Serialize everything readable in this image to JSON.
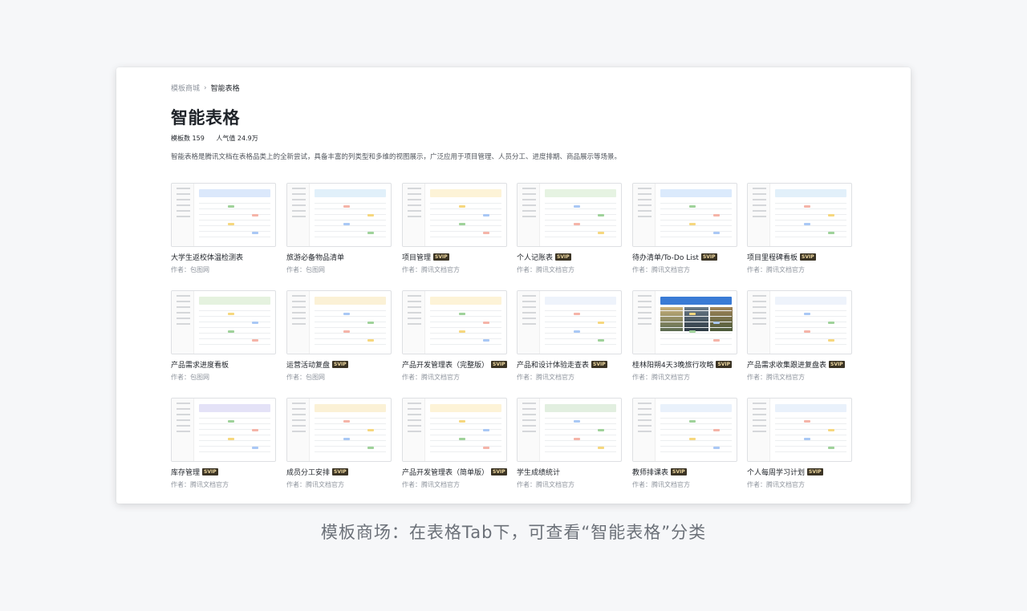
{
  "breadcrumb": {
    "parent": "模板商城",
    "current": "智能表格"
  },
  "page": {
    "title": "智能表格",
    "template_count": "模板数 159",
    "popularity": "人气值 24.9万",
    "description": "智能表格是腾讯文档在表格品类上的全新尝试，具备丰富的列类型和多维的视图展示，广泛应用于项目管理、人员分工、进度排期、商品展示等场景。"
  },
  "templates": [
    {
      "name": "大学生返校体温检测表",
      "author": "作者：包图网",
      "svip": false,
      "accent": "#dbe8fb"
    },
    {
      "name": "旅游必备物品清单",
      "author": "作者：包图网",
      "svip": false,
      "accent": "#e1f0fa"
    },
    {
      "name": "项目管理",
      "author": "作者：腾讯文档官方",
      "svip": true,
      "accent": "#fdf3d7"
    },
    {
      "name": "个人记账表",
      "author": "作者：腾讯文档官方",
      "svip": true,
      "accent": "#e6f3e2"
    },
    {
      "name": "待办清单/To-Do List",
      "author": "作者：腾讯文档官方",
      "svip": true,
      "accent": "#dbeafc"
    },
    {
      "name": "项目里程碑看板",
      "author": "作者：腾讯文档官方",
      "svip": true,
      "accent": "#e2f0fa"
    },
    {
      "name": "产品需求进度看板",
      "author": "作者：包图网",
      "svip": false,
      "accent": "#e5f2df"
    },
    {
      "name": "运营活动复盘",
      "author": "作者：包图网",
      "svip": true,
      "accent": "#fbf1d6"
    },
    {
      "name": "产品开发管理表（完整版）",
      "author": "作者：腾讯文档官方",
      "svip": true,
      "accent": "#fdf3d7"
    },
    {
      "name": "产品和设计体验走查表",
      "author": "作者：腾讯文档官方",
      "svip": true,
      "accent": "#eef3fb"
    },
    {
      "name": "桂林阳朔4天3晚旅行攻略",
      "author": "作者：腾讯文档官方",
      "svip": true,
      "accent": "#3a7bd5"
    },
    {
      "name": "产品需求收集跟进复盘表",
      "author": "作者：腾讯文档官方",
      "svip": true,
      "accent": "#eef3fb"
    },
    {
      "name": "库存管理",
      "author": "作者：腾讯文档官方",
      "svip": true,
      "accent": "#e4e2f7"
    },
    {
      "name": "成员分工安排",
      "author": "作者：腾讯文档官方",
      "svip": true,
      "accent": "#fbf1d6"
    },
    {
      "name": "产品开发管理表（简单版）",
      "author": "作者：腾讯文档官方",
      "svip": true,
      "accent": "#fdf3d7"
    },
    {
      "name": "学生成绩统计",
      "author": "作者：腾讯文档官方",
      "svip": false,
      "accent": "#e2efe0"
    },
    {
      "name": "教师排课表",
      "author": "作者：腾讯文档官方",
      "svip": true,
      "accent": "#e9f1fb"
    },
    {
      "name": "个人每周学习计划",
      "author": "作者：腾讯文档官方",
      "svip": true,
      "accent": "#e9f1fb"
    }
  ],
  "svip_label": "SVIP",
  "caption": "模板商场：在表格Tab下，可查看“智能表格”分类"
}
